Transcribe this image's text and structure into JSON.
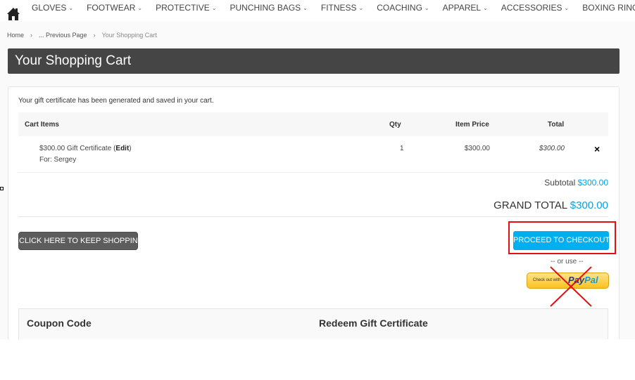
{
  "nav": {
    "items": [
      {
        "label": "GLOVES"
      },
      {
        "label": "FOOTWEAR"
      },
      {
        "label": "PROTECTIVE"
      },
      {
        "label": "PUNCHING BAGS"
      },
      {
        "label": "FITNESS"
      },
      {
        "label": "COACHING"
      },
      {
        "label": "APPAREL"
      },
      {
        "label": "ACCESSORIES"
      },
      {
        "label": "BOXING RINGS"
      }
    ],
    "caret": "⌄",
    "home_icon": "home-icon"
  },
  "breadcrumb": {
    "items": [
      {
        "label": "Home"
      },
      {
        "label": "... Previous Page"
      },
      {
        "label": "Your Shopping Cart"
      }
    ],
    "separator": "›"
  },
  "page": {
    "title": "Your Shopping Cart"
  },
  "cart": {
    "message": "Your gift certificate has been generated and saved in your cart.",
    "headers": {
      "items": "Cart Items",
      "qty": "Qty",
      "price": "Item Price",
      "total": "Total"
    },
    "rows": [
      {
        "name": "$300.00 Gift Certificate",
        "edit_open": "(",
        "edit_label": "Edit",
        "edit_close": ")",
        "for": "For: Sergey",
        "qty": "1",
        "price": "$300.00",
        "total": "$300.00",
        "remove": "×"
      }
    ],
    "subtotal_label": "Subtotal",
    "subtotal_value": "$300.00",
    "grand_label": "GRAND TOTAL",
    "grand_value": "$300.00"
  },
  "actions": {
    "keep_shopping": "CLICK HERE TO KEEP SHOPPING",
    "checkout": "PROCEED TO CHECKOUT",
    "or_use": "-- or use --",
    "paypal_small": "Check out with",
    "paypal_pay": "Pay",
    "paypal_pal": "Pal"
  },
  "coupon": {
    "coupon_title": "Coupon Code",
    "redeem_title": "Redeem Gift Certificate"
  },
  "colors": {
    "accent": "#00a4e4",
    "checkout_button": "#00aff0",
    "title_bar": "#454545",
    "highlight_box": "#e21010",
    "paypal_yellow": "#fcc21f"
  }
}
